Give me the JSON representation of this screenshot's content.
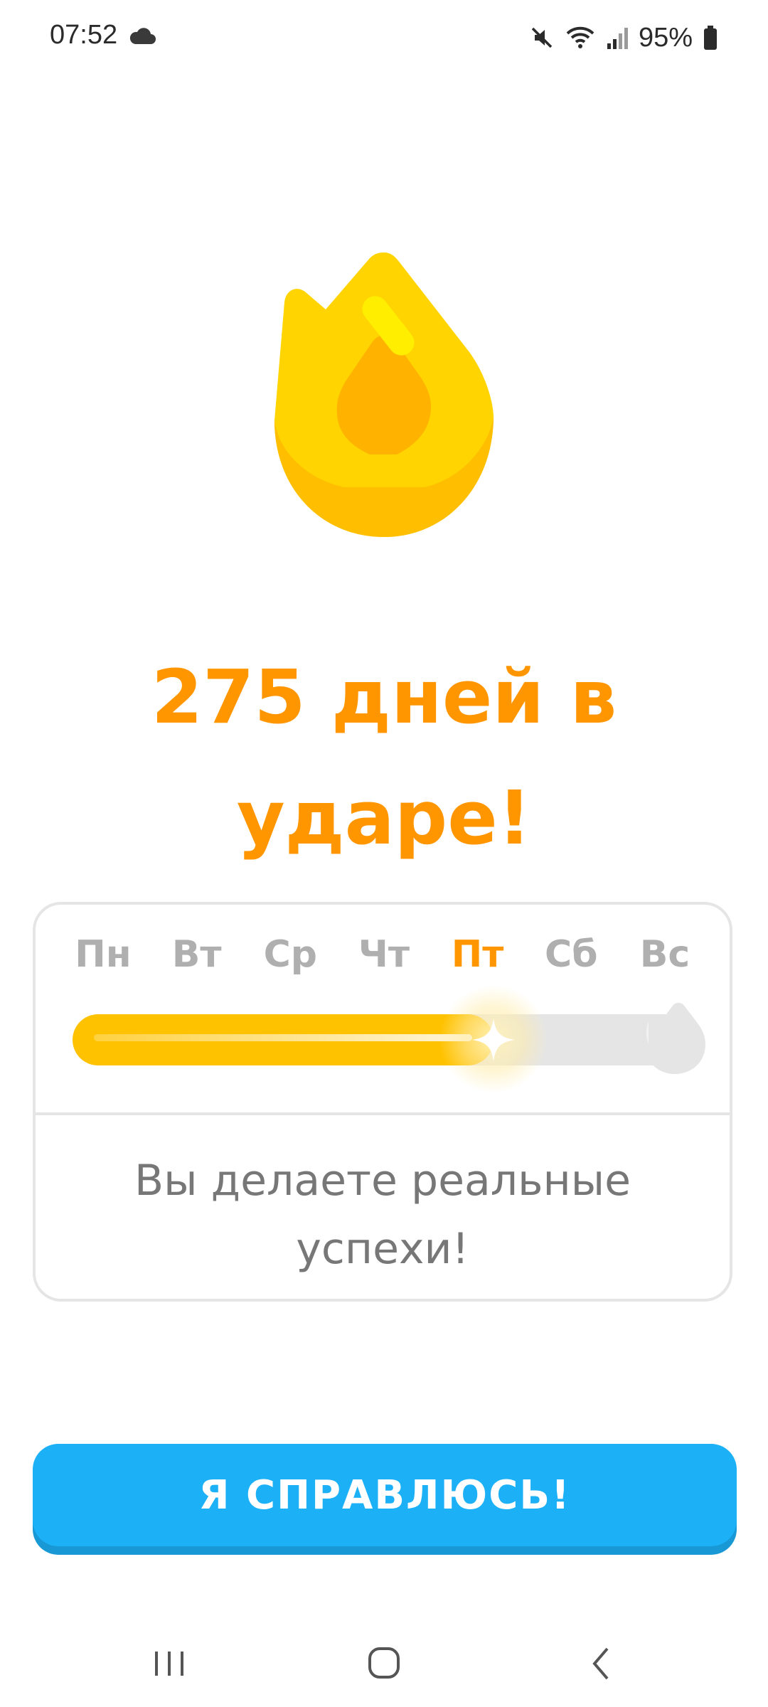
{
  "status_bar": {
    "time": "07:52",
    "battery": "95%",
    "icons": [
      "cloud-icon",
      "mute-icon",
      "wifi-icon",
      "signal-icon",
      "battery-icon"
    ]
  },
  "hero": {
    "icon": "streak-flame-icon",
    "headline_line1": "275 дней в",
    "headline_line2": "ударе!"
  },
  "streak_card": {
    "days": [
      {
        "label": "Пн",
        "active": false
      },
      {
        "label": "Вт",
        "active": false
      },
      {
        "label": "Ср",
        "active": false
      },
      {
        "label": "Чт",
        "active": false
      },
      {
        "label": "Пт",
        "active": true
      },
      {
        "label": "Сб",
        "active": false
      },
      {
        "label": "Вс",
        "active": false
      }
    ],
    "progress_fraction": 0.68,
    "message_line1": "Вы делаете реальные",
    "message_line2": "успехи!"
  },
  "cta": {
    "label": "Я СПРАВЛЮСЬ!"
  },
  "nav_bar": {
    "icons": [
      "recent-apps-icon",
      "home-icon",
      "back-icon"
    ]
  },
  "colors": {
    "accent_orange": "#ff9600",
    "flame_yellow": "#ffc800",
    "button_blue": "#1cb0f6",
    "track_gray": "#e5e5e5"
  }
}
